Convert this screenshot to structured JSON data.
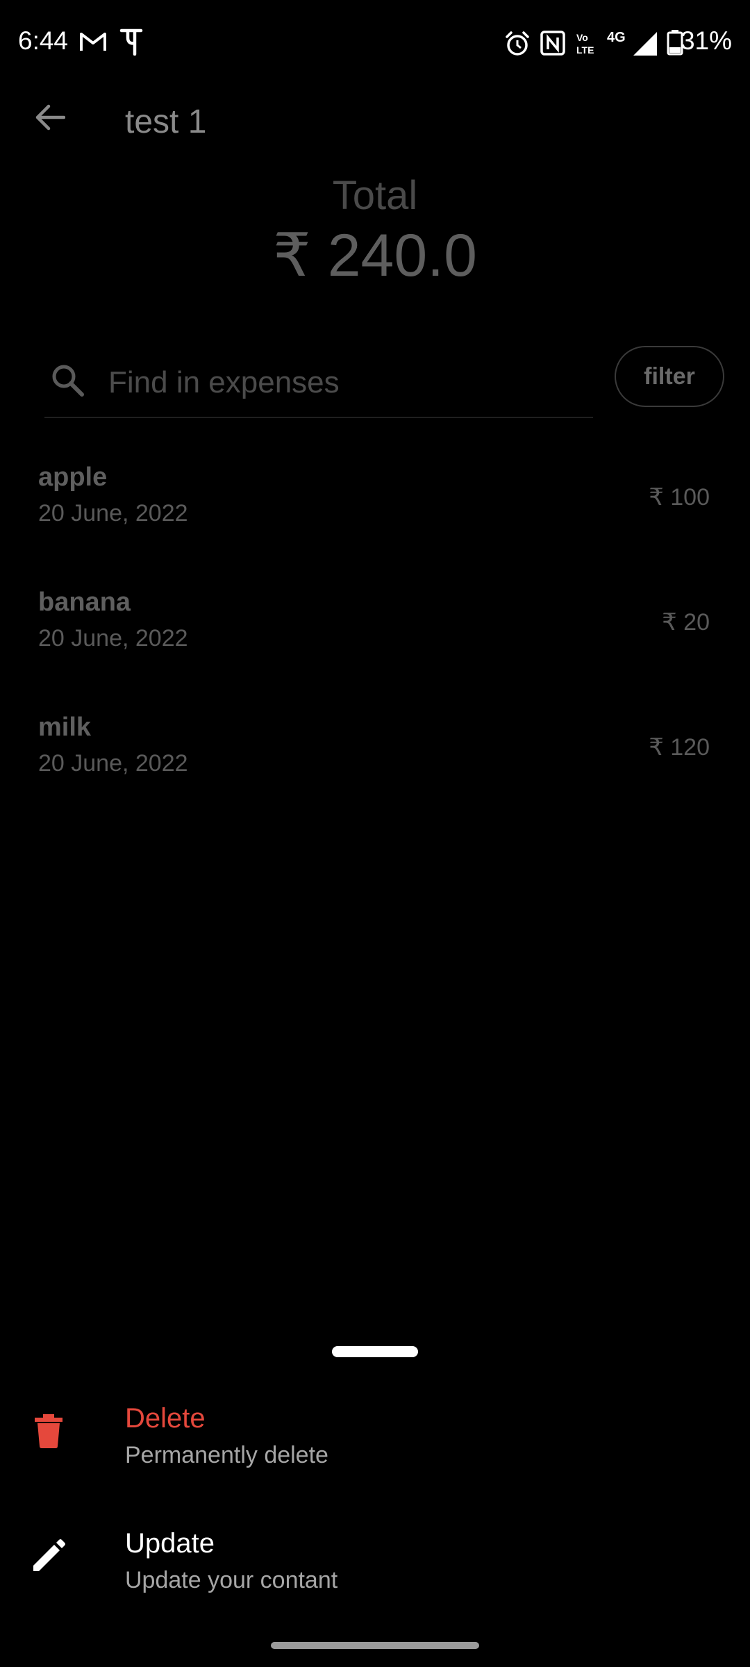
{
  "status_bar": {
    "time": "6:44",
    "network": "4G",
    "battery": "31%",
    "icons": [
      "gmail-icon",
      "phonepe-icon",
      "alarm-icon",
      "nfc-icon",
      "volte-icon",
      "4g-icon",
      "signal-icon",
      "battery-icon"
    ]
  },
  "app_bar": {
    "title": "test 1",
    "back_icon": "arrow-left-icon"
  },
  "summary": {
    "label": "Total",
    "value": "₹ 240.0"
  },
  "search": {
    "placeholder": "Find in expenses",
    "value": "",
    "filter_label": "filter"
  },
  "expenses": [
    {
      "name": "apple",
      "date": "20 June, 2022",
      "amount": "₹ 100"
    },
    {
      "name": "banana",
      "date": "20 June, 2022",
      "amount": "₹ 20"
    },
    {
      "name": "milk",
      "date": "20 June, 2022",
      "amount": "₹ 120"
    }
  ],
  "bottom_sheet": {
    "actions": [
      {
        "title": "Delete",
        "subtitle": "Permanently delete",
        "icon": "trash-icon",
        "color": "#e5483c"
      },
      {
        "title": "Update",
        "subtitle": "Update your contant",
        "icon": "pencil-icon",
        "color": "#ffffff"
      }
    ]
  },
  "colors": {
    "background": "#000000",
    "danger": "#e5483c",
    "text_dim": "#5a5a5a"
  }
}
